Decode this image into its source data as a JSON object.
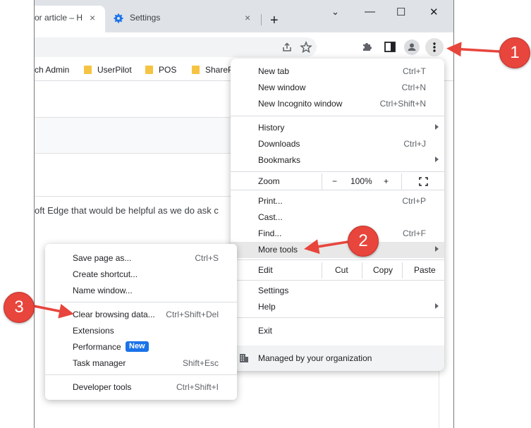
{
  "tabs": [
    {
      "title": "or article – H",
      "close": "×"
    },
    {
      "title": "Settings",
      "close": "×"
    }
  ],
  "new_tab": "+",
  "window_controls": {
    "dropdown": "⌄",
    "minimize": "—",
    "maximize": "☐",
    "close": "✕"
  },
  "bookmarks": [
    "ch Admin",
    "UserPilot",
    "POS",
    "ShareP"
  ],
  "page": {
    "body_text": "oft Edge that would be helpful as we do ask c"
  },
  "menu": {
    "items_top": [
      {
        "label": "New tab",
        "shortcut": "Ctrl+T"
      },
      {
        "label": "New window",
        "shortcut": "Ctrl+N"
      },
      {
        "label": "New Incognito window",
        "shortcut": "Ctrl+Shift+N"
      }
    ],
    "items_history": [
      {
        "label": "History",
        "shortcut": ""
      },
      {
        "label": "Downloads",
        "shortcut": "Ctrl+J"
      },
      {
        "label": "Bookmarks",
        "shortcut": ""
      }
    ],
    "zoom": {
      "label": "Zoom",
      "minus": "−",
      "value": "100%",
      "plus": "+",
      "fullscreen": "⛶"
    },
    "items_print": [
      {
        "label": "Print...",
        "shortcut": "Ctrl+P"
      },
      {
        "label": "Cast...",
        "shortcut": ""
      },
      {
        "label": "Find...",
        "shortcut": "Ctrl+F"
      },
      {
        "label": "More tools",
        "shortcut": ""
      }
    ],
    "edit": {
      "label": "Edit",
      "cut": "Cut",
      "copy": "Copy",
      "paste": "Paste"
    },
    "settings": "Settings",
    "help": "Help",
    "exit": "Exit",
    "managed": "Managed by your organization"
  },
  "submenu": {
    "items": [
      {
        "label": "Save page as...",
        "shortcut": "Ctrl+S"
      },
      {
        "label": "Create shortcut...",
        "shortcut": ""
      },
      {
        "label": "Name window...",
        "shortcut": ""
      },
      {
        "label": "Clear browsing data...",
        "shortcut": "Ctrl+Shift+Del"
      },
      {
        "label": "Extensions",
        "shortcut": ""
      },
      {
        "label": "Performance",
        "shortcut": "",
        "badge": "New"
      },
      {
        "label": "Task manager",
        "shortcut": "Shift+Esc"
      },
      {
        "label": "Developer tools",
        "shortcut": "Ctrl+Shift+I"
      }
    ]
  },
  "annotations": [
    "1",
    "2",
    "3"
  ],
  "colors": {
    "annotation": "#e8453c",
    "badge_new": "#1a73e8",
    "tabstrip": "#dfe3e8"
  }
}
